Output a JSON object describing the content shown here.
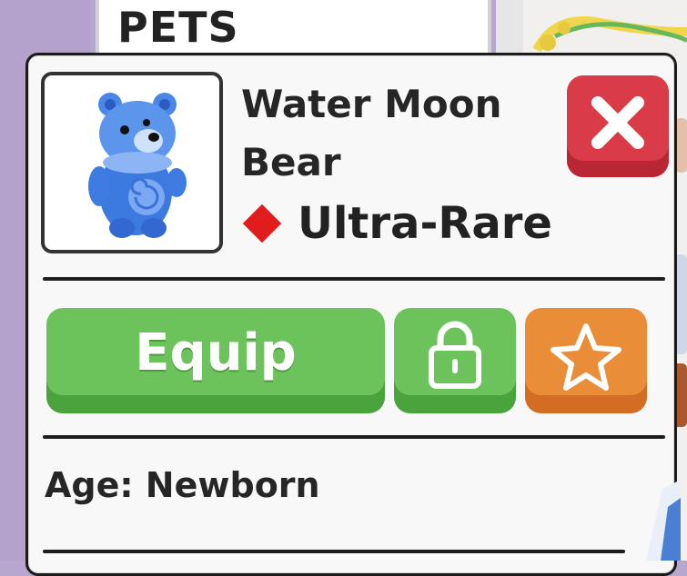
{
  "header": {
    "tab_title": "PETS"
  },
  "pet": {
    "name": "Water Moon Bear",
    "rarity": "Ultra-Rare",
    "rarity_color": "#e01c1c",
    "age_line": "Age: Newborn",
    "image_icon": "water-moon-bear-icon"
  },
  "actions": {
    "equip_label": "Equip",
    "lock_icon": "lock-icon",
    "favorite_icon": "star-icon",
    "close_icon": "close-icon"
  },
  "colors": {
    "green_button": "#6cc35b",
    "orange_button": "#ea8d38",
    "red_close": "#d93b48"
  }
}
